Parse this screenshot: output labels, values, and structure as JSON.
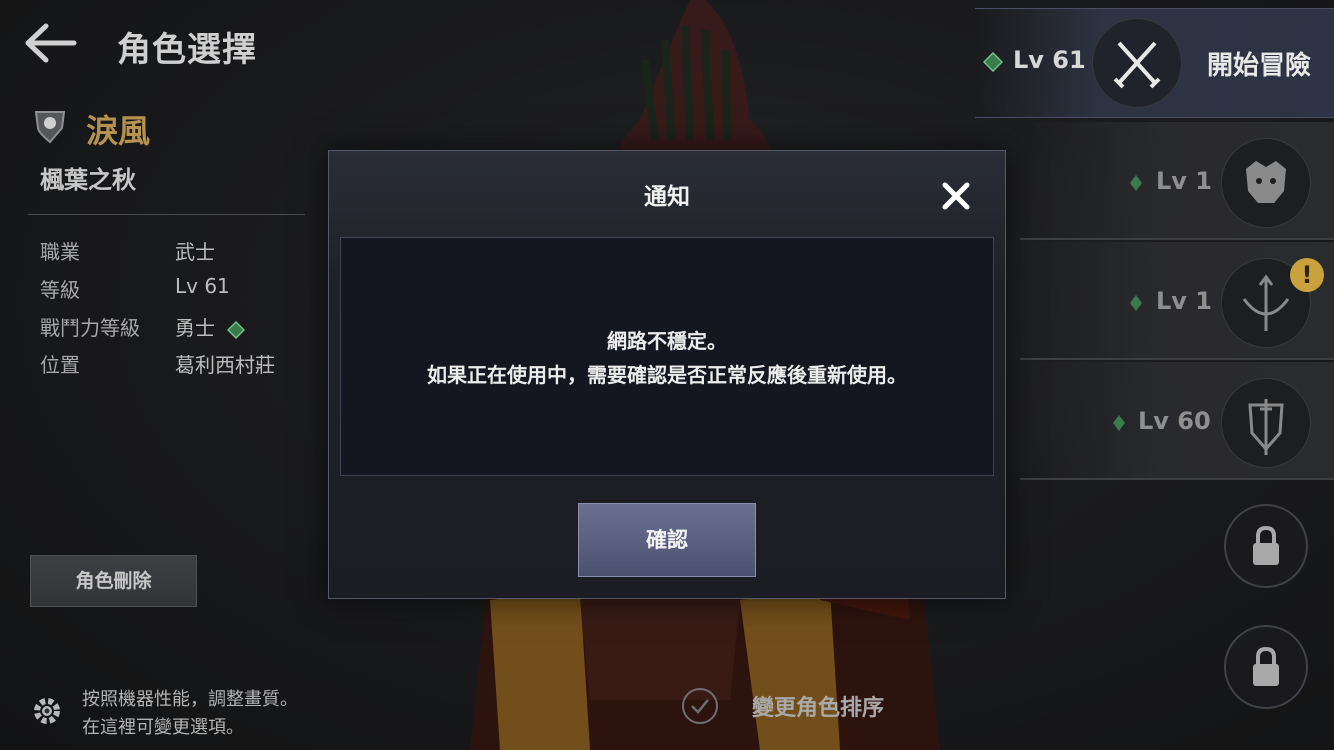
{
  "header": {
    "title": "角色選擇"
  },
  "character": {
    "name": "淚風",
    "server": "楓葉之秋",
    "info": [
      {
        "label": "職業",
        "value": "武士"
      },
      {
        "label": "等級",
        "value": "Lv 61"
      },
      {
        "label": "戰鬥力等級",
        "value": "勇士"
      },
      {
        "label": "位置",
        "value": "葛利西村莊"
      }
    ],
    "delete_label": "角色刪除"
  },
  "settings": {
    "line1": "按照機器性能，調整畫質。",
    "line2": "在這裡可變更選項。"
  },
  "slots": [
    {
      "level": "Lv 61",
      "icon": "crossed-swords-icon",
      "action": "開始冒險"
    },
    {
      "level": "Lv 1",
      "icon": "beast-head-icon"
    },
    {
      "level": "Lv 1",
      "icon": "bow-icon",
      "badge": "!"
    },
    {
      "level": "Lv 60",
      "icon": "sword-shield-icon"
    },
    {
      "locked": true,
      "icon": "lock-icon"
    },
    {
      "locked": true,
      "icon": "lock-icon"
    }
  ],
  "reorder_label": "變更角色排序",
  "modal": {
    "title": "通知",
    "message_line1": "網路不穩定。",
    "message_line2": "如果正在使用中，需要確認是否正常反應後重新使用。",
    "confirm_label": "確認"
  },
  "colors": {
    "accent_gold": "#b5924f",
    "gem_green": "#5fae72",
    "confirm_button": "#5a5f80"
  }
}
